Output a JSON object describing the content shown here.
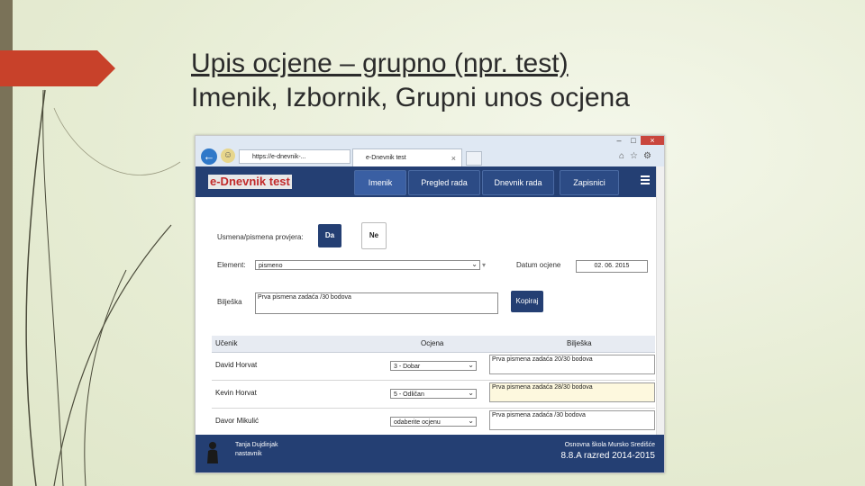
{
  "slide": {
    "title_line1": "Upis ocjene – grupno (npr. test)",
    "title_line2": "Imenik, Izbornik, Grupni unos ocjena"
  },
  "browser": {
    "address": "https://e-dnevnik-...",
    "tab_title": "e-Dnevnik test",
    "tab_close": "×",
    "win_min": "–",
    "win_max": "□",
    "win_close": "×",
    "back_icon": "arrow-left",
    "accent": "#243f73"
  },
  "app": {
    "logo": "e-Dnevnik test",
    "nav": [
      "Imenik",
      "Pregled rada",
      "Dnevnik rada",
      "Zapisnici"
    ]
  },
  "form": {
    "usmena_label": "Usmena/pismena provjera:",
    "da_label": "Da",
    "ne_label": "Ne",
    "element_label": "Element:",
    "element_value": "pismeno",
    "datum_label": "Datum ocjene",
    "datum_value": "02. 06. 2015",
    "biljeska_label": "Bilješka",
    "biljeska_value": "Prva pismena zadaća /30 bodova",
    "kopiraj_label": "Kopiraj"
  },
  "table": {
    "headers": [
      "Učenik",
      "Ocjena",
      "Bilješka"
    ],
    "rows": [
      {
        "name": "David Horvat",
        "grade": "3 - Dobar",
        "note": "Prva pismena zadaća 20/30 bodova"
      },
      {
        "name": "Kevin Horvat",
        "grade": "5 - Odličan",
        "note": "Prva pismena zadaća 28/30 bodova"
      },
      {
        "name": "Davor Mikulić",
        "grade": "odaberite ocjenu",
        "note": "Prva pismena zadaća /30 bodova"
      }
    ]
  },
  "footer": {
    "user_name": "Tanja Dujdinjak",
    "user_role": "nastavnik",
    "school": "Osnovna škola Mursko Središće",
    "class_year": "8.8.A razred 2014-2015"
  }
}
